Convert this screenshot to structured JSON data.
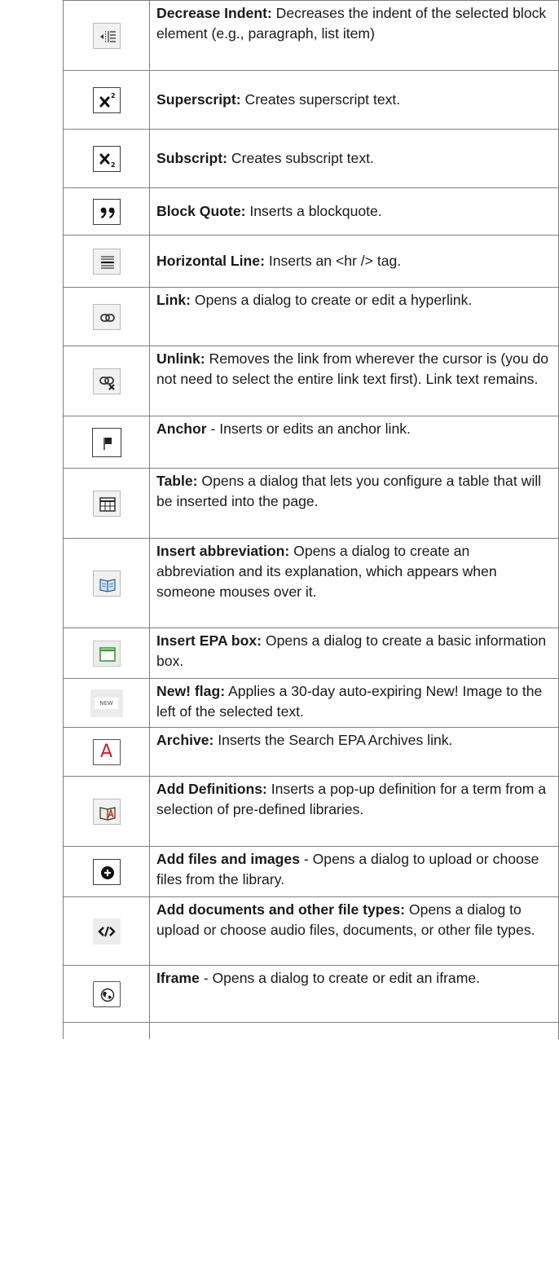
{
  "rows": [
    {
      "icon": "decrease-indent-icon",
      "term": "Decrease Indent:",
      "desc": " Decreases the indent of the selected block element (e.g., paragraph, list item)"
    },
    {
      "icon": "superscript-icon",
      "term": "Superscript:",
      "desc": " Creates superscript text."
    },
    {
      "icon": "subscript-icon",
      "term": "Subscript:",
      "desc": " Creates subscript text."
    },
    {
      "icon": "block-quote-icon",
      "term": "Block Quote:",
      "desc": " Inserts a blockquote."
    },
    {
      "icon": "horizontal-line-icon",
      "term": "Horizontal Line:",
      "desc": " Inserts an <hr /> tag."
    },
    {
      "icon": "link-icon",
      "term": "Link:",
      "desc": " Opens a dialog to create or edit a hyperlink."
    },
    {
      "icon": "unlink-icon",
      "term": "Unlink:",
      "desc": " Removes the link from wherever the cursor is (you do not need to select the entire link text first). Link text remains."
    },
    {
      "icon": "anchor-flag-icon",
      "term": "Anchor",
      "desc": " - Inserts or edits an anchor link."
    },
    {
      "icon": "table-icon",
      "term": "Table:",
      "desc": " Opens a dialog that lets you configure a table that will be inserted into the page."
    },
    {
      "icon": "abbreviation-book-icon",
      "term": "Insert abbreviation:",
      "desc": " Opens a dialog to create an abbreviation and its explanation, which appears when someone mouses over it."
    },
    {
      "icon": "epa-box-icon",
      "term": "Insert EPA box:",
      "desc": " Opens a dialog to create a basic information box."
    },
    {
      "icon": "new-flag-icon",
      "term": "New! flag:",
      "desc": " Applies a 30-day auto-expiring New! Image to the left of the selected text.",
      "icon_text": "NEW"
    },
    {
      "icon": "archive-icon",
      "term": "Archive:",
      "desc": " Inserts the Search EPA Archives link.",
      "icon_text": "A"
    },
    {
      "icon": "definitions-book-icon",
      "term": "Add Definitions:",
      "desc": " Inserts a pop-up definition for a term from a selection of pre-defined libraries."
    },
    {
      "icon": "add-files-plus-icon",
      "term": "Add files and images",
      "desc": " - Opens a dialog to upload or choose files from the library."
    },
    {
      "icon": "code-icon",
      "term": "Add documents and other file types:",
      "desc": " Opens a dialog to upload or choose audio files, documents, or other file types."
    },
    {
      "icon": "globe-icon",
      "term": "Iframe",
      "desc": " - Opens a dialog to create or edit an iframe."
    }
  ]
}
